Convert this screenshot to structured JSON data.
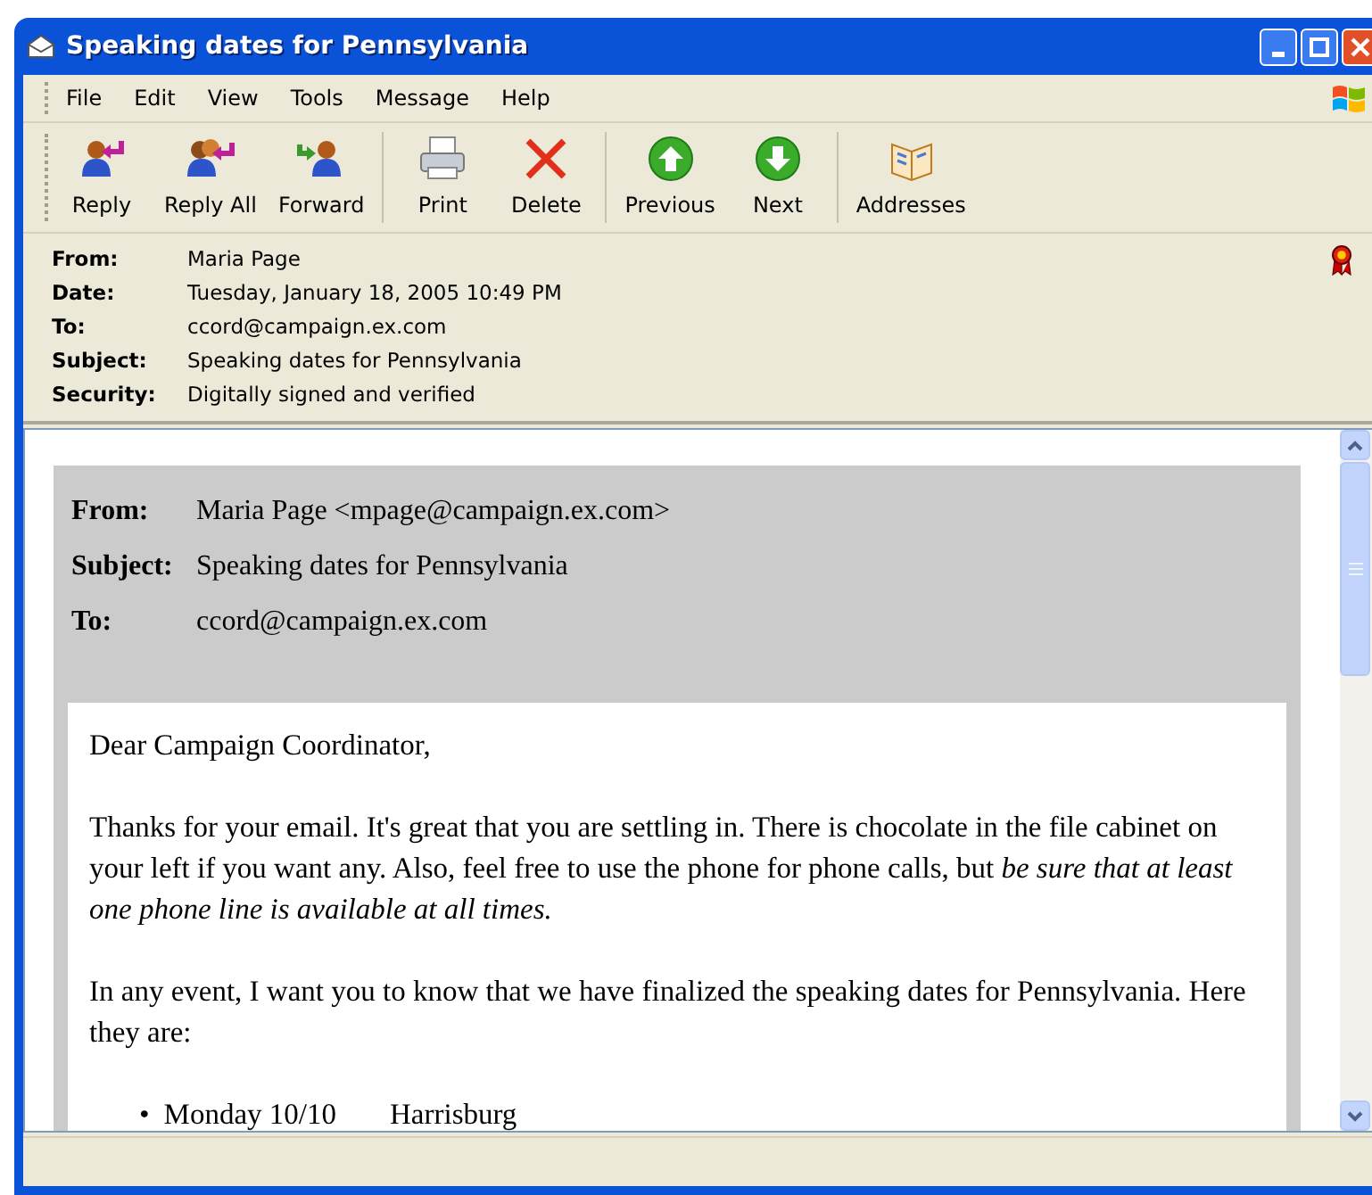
{
  "window": {
    "title": "Speaking dates for Pennsylvania"
  },
  "menu": [
    "File",
    "Edit",
    "View",
    "Tools",
    "Message",
    "Help"
  ],
  "toolbar": [
    [
      {
        "label": "Reply"
      },
      {
        "label": "Reply All"
      },
      {
        "label": "Forward"
      }
    ],
    [
      {
        "label": "Print"
      },
      {
        "label": "Delete"
      }
    ],
    [
      {
        "label": "Previous"
      },
      {
        "label": "Next"
      }
    ],
    [
      {
        "label": "Addresses"
      }
    ]
  ],
  "headers": [
    {
      "label": "From:",
      "value": "Maria Page"
    },
    {
      "label": "Date:",
      "value": "Tuesday, January 18, 2005 10:49 PM"
    },
    {
      "label": "To:",
      "value": "ccord@campaign.ex.com"
    },
    {
      "label": "Subject:",
      "value": "Speaking dates for Pennsylvania"
    },
    {
      "label": "Security:",
      "value": "Digitally signed and verified"
    }
  ],
  "message": {
    "headers": [
      {
        "label": "From:",
        "value": "Maria Page <mpage@campaign.ex.com>"
      },
      {
        "label": "Subject:",
        "value": "Speaking dates for Pennsylvania"
      },
      {
        "label": "To:",
        "value": "ccord@campaign.ex.com"
      }
    ],
    "paragraphs": [
      "Dear Campaign Coordinator,",
      "Thanks for your email. It's great that you are settling in. There is chocolate in the file cabinet on your left if you want any. Also, feel free to use the phone for phone calls, but *be sure that at least one phone line is available at all times.*",
      "In any event, I want you to know that we have finalized the speaking dates for Pennsylvania. Here they are:"
    ],
    "dates": [
      {
        "bullet": "•",
        "day": "Monday 10/10",
        "place": "Harrisburg"
      }
    ]
  }
}
